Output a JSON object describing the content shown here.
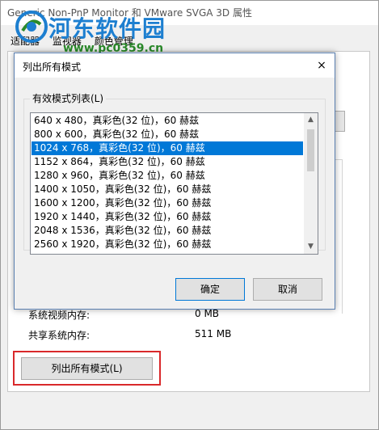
{
  "background_window": {
    "title": "Generic Non-PnP Monitor 和 VMware SVGA 3D 属性",
    "tabs": [
      "适配器",
      "监视器",
      "颜色管理"
    ],
    "rows": [
      {
        "label": "系统视频内存:",
        "value": "0 MB"
      },
      {
        "label": "共享系统内存:",
        "value": "511 MB"
      }
    ],
    "list_all_modes_button": "列出所有模式(L)"
  },
  "watermark": {
    "text": "河东软件园",
    "url": "www.pc0359.cn"
  },
  "dialog": {
    "title": "列出所有模式",
    "close_icon": "×",
    "group_label": "有效模式列表(L)",
    "modes": [
      "640 x 480，真彩色(32 位)，60 赫兹",
      "800 x 600，真彩色(32 位)，60 赫兹",
      "1024 x 768，真彩色(32 位)，60 赫兹",
      "1152 x 864，真彩色(32 位)，60 赫兹",
      "1280 x 960，真彩色(32 位)，60 赫兹",
      "1400 x 1050，真彩色(32 位)，60 赫兹",
      "1600 x 1200，真彩色(32 位)，60 赫兹",
      "1920 x 1440，真彩色(32 位)，60 赫兹",
      "2048 x 1536，真彩色(32 位)，60 赫兹",
      "2560 x 1920，真彩色(32 位)，60 赫兹"
    ],
    "selected_index": 2,
    "ok_label": "确定",
    "cancel_label": "取消",
    "scroll_up_icon": "▲",
    "scroll_down_icon": "▼"
  },
  "colors": {
    "selection": "#0078d7",
    "highlight_box": "#d9292b",
    "watermark_blue": "#1d7fd0",
    "watermark_green": "#2a8a2a"
  }
}
